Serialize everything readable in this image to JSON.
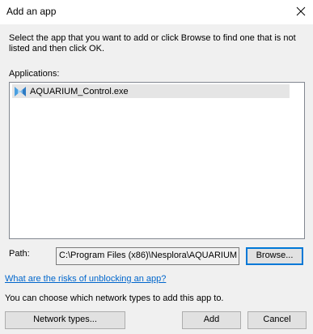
{
  "window": {
    "title": "Add an app"
  },
  "description": "Select the app that you want to add or click Browse to find one that is not listed and then click OK.",
  "applications": {
    "label": "Applications:",
    "items": [
      {
        "name": "AQUARIUM_Control.exe",
        "icon": "app-icon"
      }
    ]
  },
  "path": {
    "label": "Path:",
    "value": "C:\\Program Files (x86)\\Nesplora\\AQUARIUM -",
    "browse_label": "Browse..."
  },
  "risks_link": "What are the risks of unblocking an app?",
  "network_text": "You can choose which network types to add this app to.",
  "buttons": {
    "network_types": "Network types...",
    "add": "Add",
    "cancel": "Cancel"
  },
  "colors": {
    "link": "#0066cc",
    "focus_border": "#0078d7",
    "selected_item": "#e5e5e5",
    "dialog_bg": "#f0f0f0"
  }
}
